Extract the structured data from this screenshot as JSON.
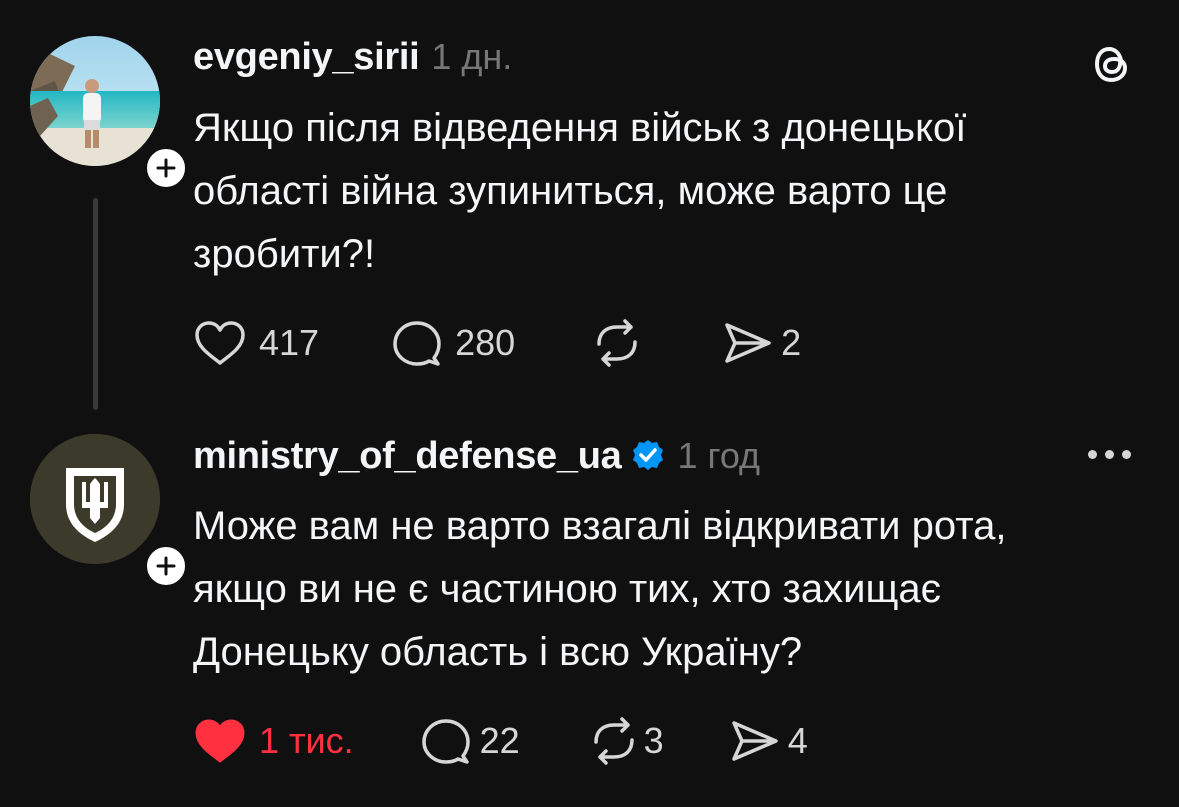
{
  "post1": {
    "username": "evgeniy_sirii",
    "timestamp": "1 дн.",
    "text_lines": [
      "Якщо після відведення військ з донецької",
      "області війна зупиниться, може варто це",
      "зробити?!"
    ],
    "likes": "417",
    "comments": "280",
    "reposts": "",
    "shares": "2",
    "app_icon": "threads-icon"
  },
  "post2": {
    "username": "ministry_of_defense_ua",
    "timestamp": "1 год",
    "verified": true,
    "text_lines": [
      "Може вам не варто взагалі відкривати рота,",
      "якщо ви не є частиною тих, хто захищає",
      "Донецьку область і всю Україну?"
    ],
    "likes": "1 тис.",
    "liked": true,
    "comments": "22",
    "reposts": "3",
    "shares": "4"
  },
  "colors": {
    "background": "#101010",
    "text": "#f3f5f7",
    "muted": "#777777",
    "like_red": "#ff3040",
    "verified_blue": "#0095f6"
  }
}
